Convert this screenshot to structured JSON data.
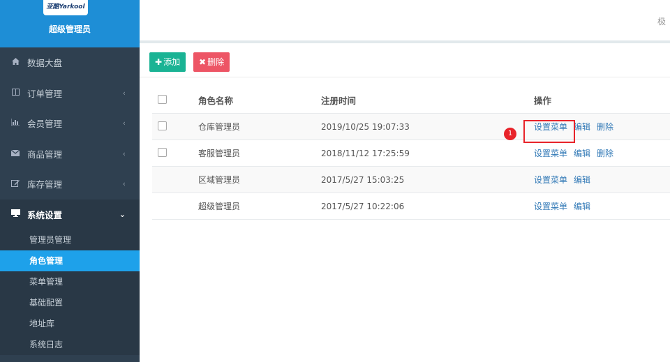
{
  "brand": {
    "logo_text": "亚酷Yarkool",
    "title": "超级管理员",
    "bg_color": "#1e8ed6"
  },
  "sidebar": {
    "items": [
      {
        "icon": "home-icon",
        "label": "数据大盘",
        "has_children": false
      },
      {
        "icon": "columns-icon",
        "label": "订单管理",
        "has_children": true
      },
      {
        "icon": "bar-chart-icon",
        "label": "会员管理",
        "has_children": true
      },
      {
        "icon": "envelope-icon",
        "label": "商品管理",
        "has_children": true
      },
      {
        "icon": "edit-icon",
        "label": "库存管理",
        "has_children": true
      },
      {
        "icon": "desktop-icon",
        "label": "系统设置",
        "has_children": true,
        "open": true
      }
    ],
    "subitems": [
      {
        "label": "管理员管理",
        "active": false
      },
      {
        "label": "角色管理",
        "active": true
      },
      {
        "label": "菜单管理",
        "active": false
      },
      {
        "label": "基础配置",
        "active": false
      },
      {
        "label": "地址库",
        "active": false
      },
      {
        "label": "系统日志",
        "active": false
      }
    ]
  },
  "topbar": {
    "right_text": "极"
  },
  "toolbar": {
    "add_icon": "plus-icon",
    "add_label": "添加",
    "delete_icon": "times-icon",
    "delete_label": "删除"
  },
  "table": {
    "headers": {
      "name": "角色名称",
      "time": "注册时间",
      "ops": "操作"
    },
    "rows": [
      {
        "checkbox": true,
        "name": "仓库管理员",
        "time": "2019/10/25 19:07:33",
        "ops": [
          "设置菜单",
          "编辑",
          "删除"
        ]
      },
      {
        "checkbox": true,
        "name": "客服管理员",
        "time": "2018/11/12 17:25:59",
        "ops": [
          "设置菜单",
          "编辑",
          "删除"
        ]
      },
      {
        "checkbox": false,
        "name": "区域管理员",
        "time": "2017/5/27 15:03:25",
        "ops": [
          "设置菜单",
          "编辑"
        ]
      },
      {
        "checkbox": false,
        "name": "超级管理员",
        "time": "2017/5/27 10:22:06",
        "ops": [
          "设置菜单",
          "编辑"
        ]
      }
    ]
  },
  "annotation": {
    "badge": "1",
    "color": "#e8232a"
  },
  "colors": {
    "sidebar": "#2f4050",
    "active": "#1ea1ea",
    "add": "#1ab394",
    "delete": "#ed5565",
    "link": "#337ab7"
  }
}
